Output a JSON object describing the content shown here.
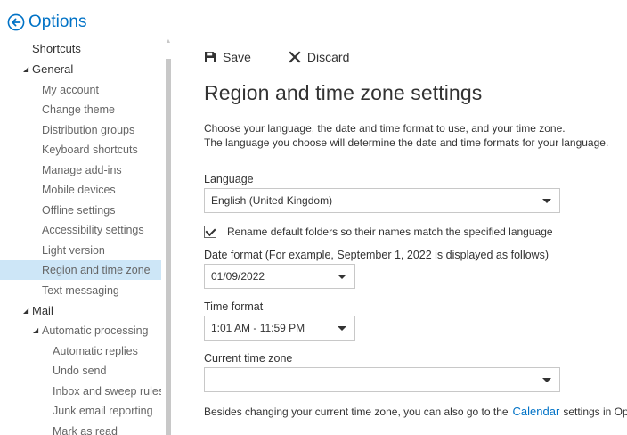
{
  "header": {
    "title": "Options"
  },
  "sidebar": {
    "items": [
      {
        "label": "Shortcuts"
      },
      {
        "label": "General"
      },
      {
        "label": "My account"
      },
      {
        "label": "Change theme"
      },
      {
        "label": "Distribution groups"
      },
      {
        "label": "Keyboard shortcuts"
      },
      {
        "label": "Manage add-ins"
      },
      {
        "label": "Mobile devices"
      },
      {
        "label": "Offline settings"
      },
      {
        "label": "Accessibility settings"
      },
      {
        "label": "Light version"
      },
      {
        "label": "Region and time zone"
      },
      {
        "label": "Text messaging"
      },
      {
        "label": "Mail"
      },
      {
        "label": "Automatic processing"
      },
      {
        "label": "Automatic replies"
      },
      {
        "label": "Undo send"
      },
      {
        "label": "Inbox and sweep rules"
      },
      {
        "label": "Junk email reporting"
      },
      {
        "label": "Mark as read"
      }
    ]
  },
  "toolbar": {
    "save_label": "Save",
    "discard_label": "Discard"
  },
  "main": {
    "title": "Region and time zone settings",
    "desc_line1": "Choose your language, the date and time format to use, and your time zone.",
    "desc_line2": "The language you choose will determine the date and time formats for your language.",
    "language": {
      "label": "Language",
      "value": "English (United Kingdom)"
    },
    "rename_checkbox": {
      "label": "Rename default folders so their names match the specified language",
      "checked": true
    },
    "date_format": {
      "label": "Date format (For example, September 1, 2022 is displayed as follows)",
      "value": "01/09/2022"
    },
    "time_format": {
      "label": "Time format",
      "value": "1:01 AM - 11:59 PM"
    },
    "time_zone": {
      "label": "Current time zone",
      "value": ""
    },
    "footer": {
      "text_before": "Besides changing your current time zone, you can also go to the",
      "link": "Calendar",
      "text_after": "settings in Op"
    }
  },
  "colors": {
    "accent": "#0072c6",
    "selected_bg": "#cde6f7"
  }
}
